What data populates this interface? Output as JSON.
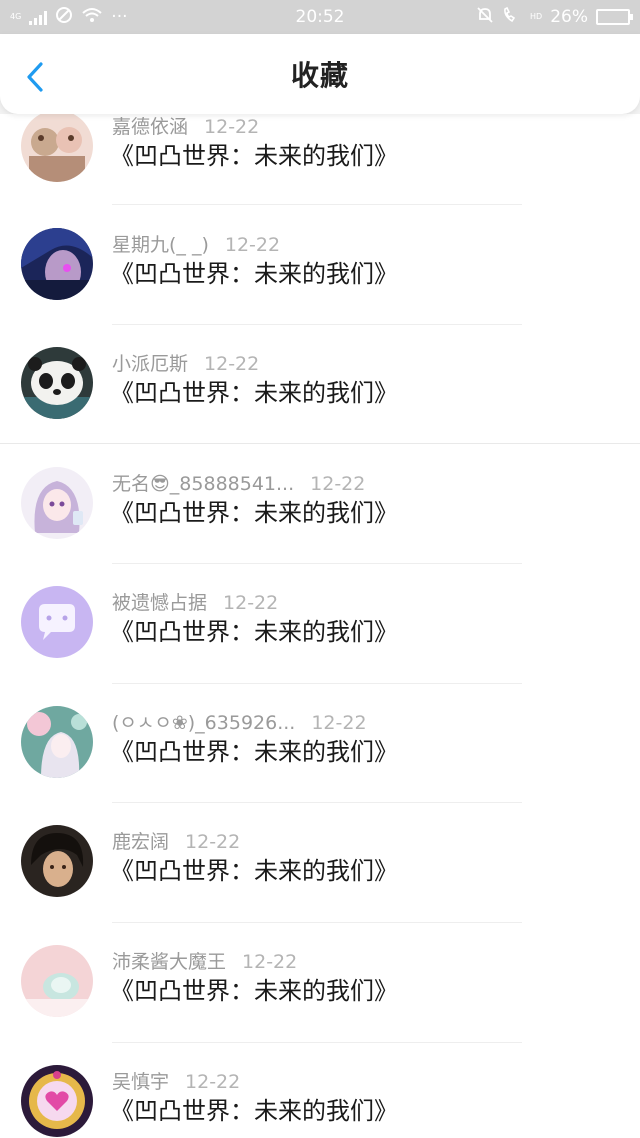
{
  "status_bar": {
    "network": "4G",
    "time": "20:52",
    "hd": "HD",
    "battery": "26%",
    "battery_level": 0.26,
    "icons": [
      "signal-icon",
      "blocked-icon",
      "wifi-icon",
      "more-dots-icon",
      "bell-muted-icon",
      "hd-call-icon",
      "battery-icon"
    ]
  },
  "header": {
    "title": "收藏",
    "back_icon": "chevron-left-icon",
    "accent": "#1f9bf0"
  },
  "messages": [
    {
      "name": "嘉德依涵",
      "date": "12-22",
      "text": "《凹凸世界：未来的我们》"
    },
    {
      "name": "星期九(_ _)",
      "date": "12-22",
      "text": "《凹凸世界：未来的我们》"
    },
    {
      "name": "小派厄斯",
      "date": "12-22",
      "text": "《凹凸世界：未来的我们》"
    },
    {
      "name": "无名😎_85888541...",
      "date": "12-22",
      "text": "《凹凸世界：未来的我们》"
    },
    {
      "name": "被遗憾占据",
      "date": "12-22",
      "text": "《凹凸世界：未来的我们》"
    },
    {
      "name": "(ㅇㅅㅇ❀)_635926...",
      "date": "12-22",
      "text": "《凹凸世界：未来的我们》"
    },
    {
      "name": "鹿宏阔",
      "date": "12-22",
      "text": "《凹凸世界：未来的我们》"
    },
    {
      "name": "沛柔酱大魔王",
      "date": "12-22",
      "text": "《凹凸世界：未来的我们》"
    },
    {
      "name": "吴慎宇",
      "date": "12-22",
      "text": "《凹凸世界：未来的我们》"
    }
  ]
}
